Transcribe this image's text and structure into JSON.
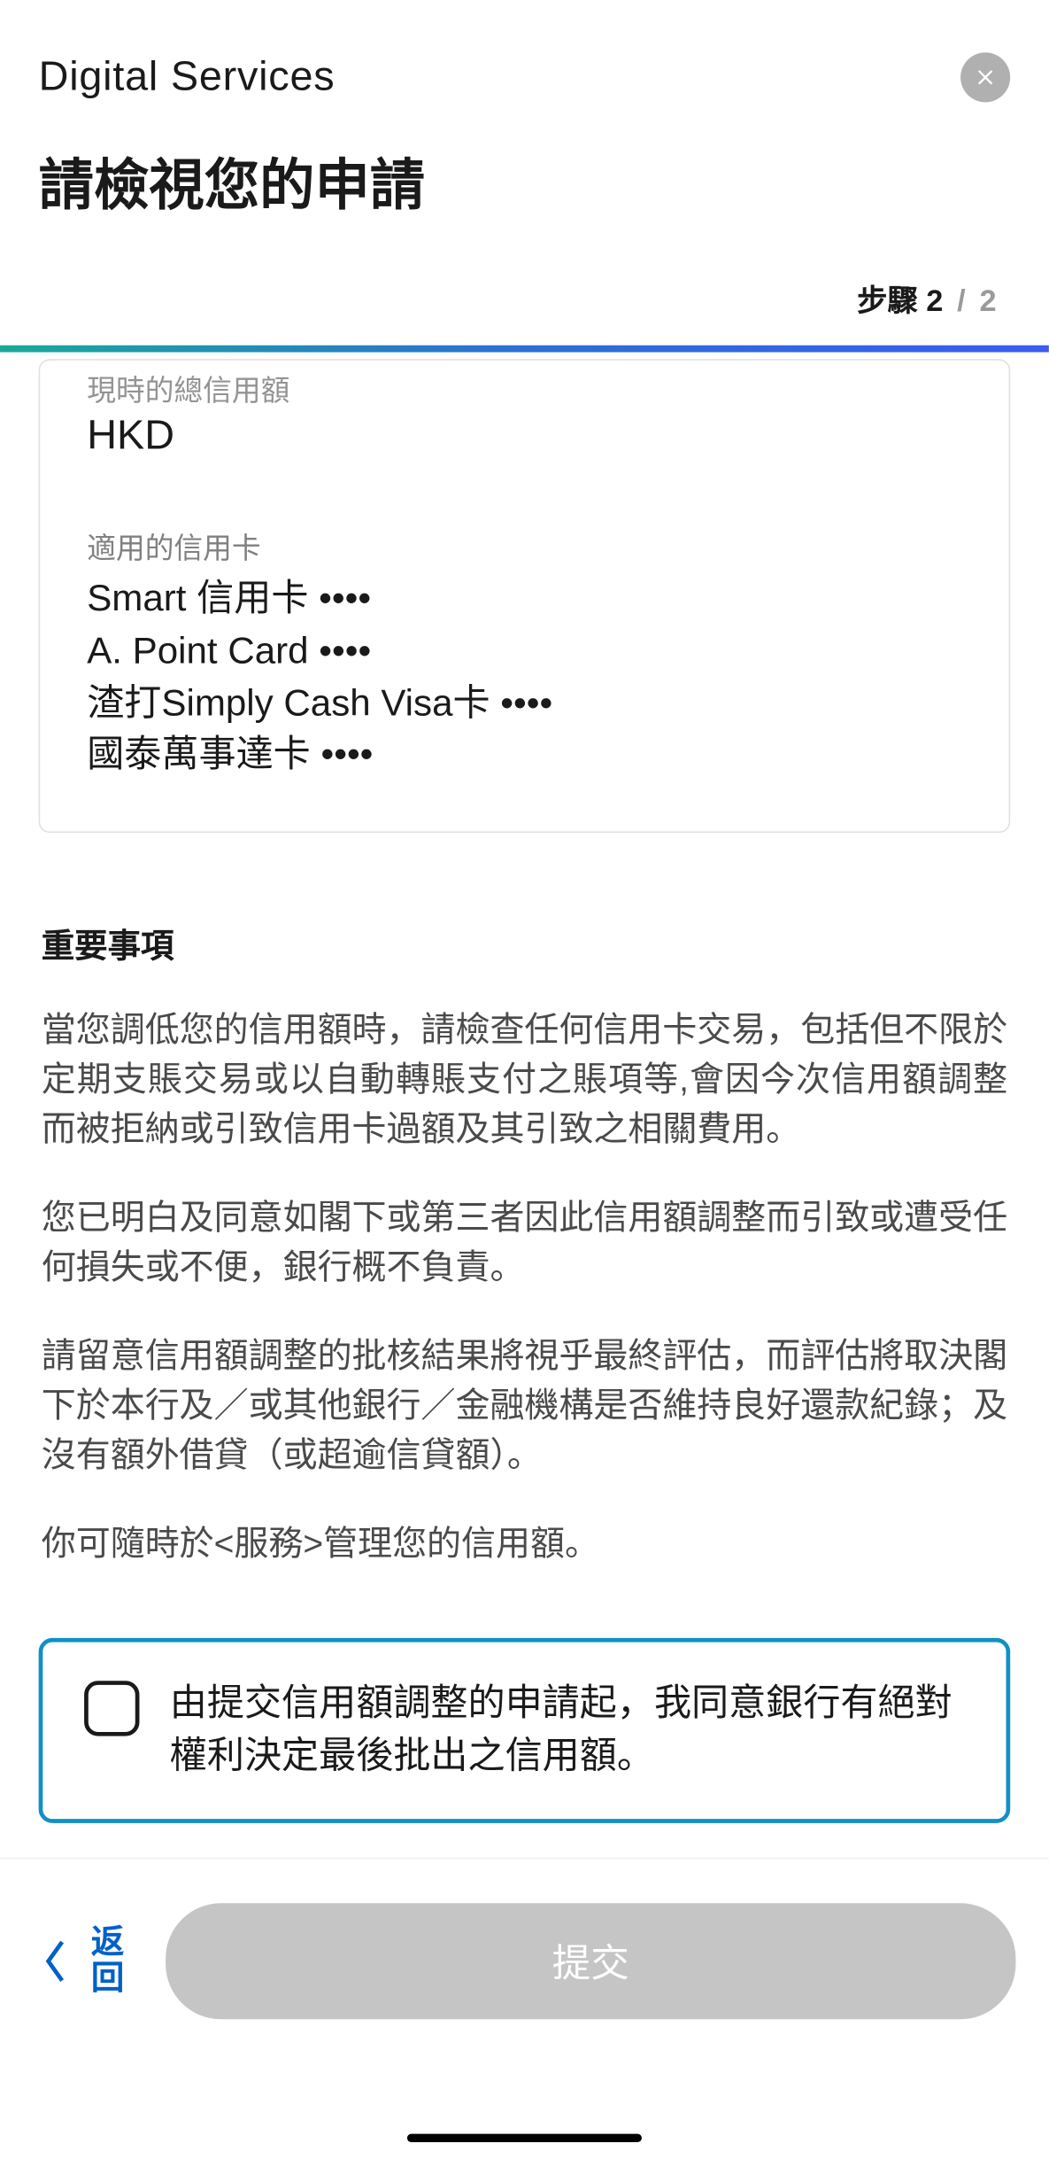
{
  "header": {
    "app_title": "Digital Services",
    "page_title": "請檢視您的申請"
  },
  "step": {
    "label": "步驟",
    "current": "2",
    "divider": "/",
    "total": "2"
  },
  "card": {
    "credit_limit_label": "現時的總信用額",
    "credit_limit_value": "HKD",
    "applicable_label": "適用的信用卡",
    "cards": [
      "Smart 信用卡 ••••",
      "A. Point Card ••••",
      "渣打Simply Cash Visa卡 ••••",
      "國泰萬事達卡 ••••"
    ]
  },
  "important": {
    "title": "重要事項",
    "paragraphs": [
      "當您調低您的信用額時，請檢查任何信用卡交易，包括但不限於定期支賬交易或以自動轉賬支付之賬項等,會因今次信用額調整而被拒納或引致信用卡過額及其引致之相關費用。",
      "您已明白及同意如閣下或第三者因此信用額調整而引致或遭受任何損失或不便，銀行概不負責。",
      "請留意信用額調整的批核結果將視乎最終評估，而評估將取決閣下於本行及／或其他銀行／金融機構是否維持良好還款紀錄；及沒有額外借貸（或超逾信貸額）。",
      "你可隨時於<服務>管理您的信用額。"
    ]
  },
  "consent": {
    "text": "由提交信用額調整的申請起，我同意銀行有絕對權利決定最後批出之信用額。"
  },
  "footer": {
    "back": "返回",
    "submit": "提交"
  }
}
